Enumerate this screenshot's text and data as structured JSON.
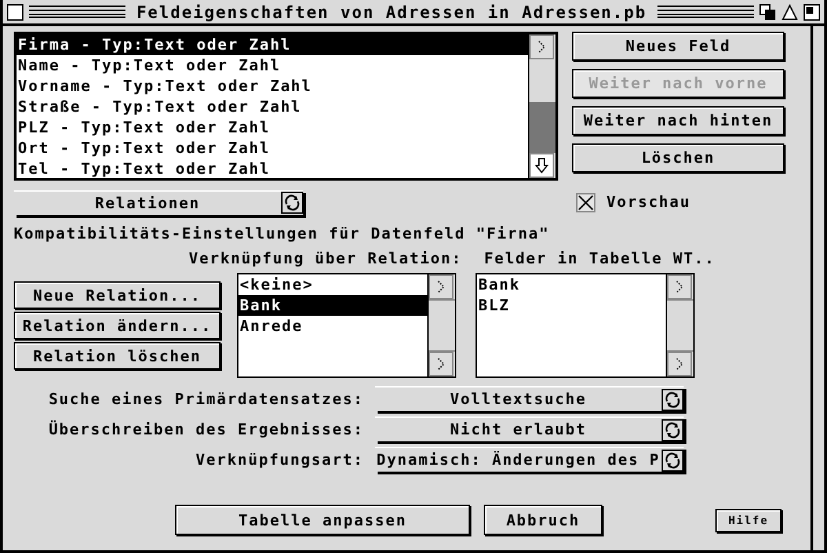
{
  "window": {
    "title": "Feldeigenschaften von Adressen in Adressen.pb"
  },
  "field_list": {
    "items": [
      {
        "label": "Firma - Typ:Text oder Zahl",
        "selected": true
      },
      {
        "label": "Name - Typ:Text oder Zahl",
        "selected": false
      },
      {
        "label": "Vorname - Typ:Text oder Zahl",
        "selected": false
      },
      {
        "label": "Straße - Typ:Text oder Zahl",
        "selected": false
      },
      {
        "label": "PLZ - Typ:Text oder Zahl",
        "selected": false
      },
      {
        "label": "Ort - Typ:Text oder Zahl",
        "selected": false
      },
      {
        "label": "Tel - Typ:Text oder Zahl",
        "selected": false
      }
    ]
  },
  "field_buttons": [
    {
      "label": "Neues Feld",
      "disabled": false
    },
    {
      "label": "Weiter nach vorne",
      "disabled": true
    },
    {
      "label": "Weiter nach hinten",
      "disabled": false
    },
    {
      "label": "Löschen",
      "disabled": false
    }
  ],
  "relations_popup": {
    "value": "Relationen"
  },
  "preview": {
    "label": "Vorschau",
    "checked": true
  },
  "compat_label": "Kompatibilitäts-Einstellungen für Datenfeld \"Firna\"",
  "relation_header": "Verknüpfung über Relation:",
  "fields_header": "Felder in Tabelle WT..",
  "relation_buttons": [
    "Neue Relation...",
    "Relation ändern...",
    "Relation löschen"
  ],
  "relation_list": {
    "items": [
      {
        "label": "<keine>",
        "selected": false
      },
      {
        "label": "Bank",
        "selected": true
      },
      {
        "label": "Anrede",
        "selected": false
      }
    ]
  },
  "fields_list": {
    "items": [
      "Bank",
      "BLZ"
    ]
  },
  "settings": [
    {
      "label": "Suche eines Primärdatensatzes:",
      "value": "Volltextsuche"
    },
    {
      "label": "Überschreiben des Ergebnisses:",
      "value": "Nicht erlaubt"
    },
    {
      "label": "Verknüpfungsart:",
      "value": "Dynamisch: Änderungen des P"
    }
  ],
  "footer_buttons": [
    "Tabelle anpassen",
    "Abbruch"
  ],
  "help_button": "Hilfe"
}
